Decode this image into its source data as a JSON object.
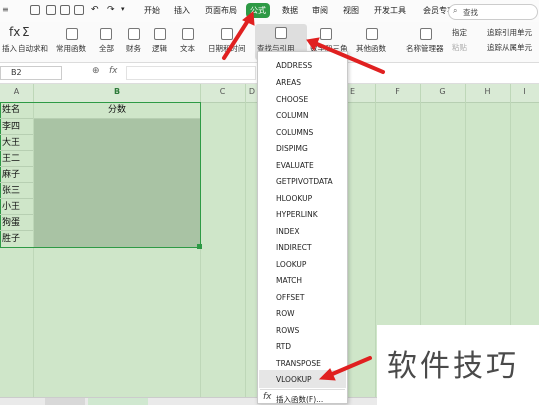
{
  "menu": {
    "items": [
      "开始",
      "插入",
      "页面布局",
      "公式",
      "数据",
      "审阅",
      "视图",
      "开发工具",
      "会员专享"
    ],
    "active": "公式",
    "search_label": "查找"
  },
  "ribbon": {
    "insert_func_label": "插入",
    "buttons": [
      "自动求和",
      "常用函数",
      "全部",
      "财务",
      "逻辑",
      "文本",
      "日期和时间",
      "查找与引用",
      "数学和三角",
      "其他函数",
      "名称管理器"
    ],
    "right_items": [
      "指定",
      "粘贴",
      "追踪引用单元",
      "追踪从属单元"
    ]
  },
  "formula_bar": {
    "cell_ref": "B2",
    "fx": "fx"
  },
  "sheet": {
    "col_headers": [
      "A",
      "B",
      "C",
      "D",
      "E",
      "F",
      "G",
      "H",
      "I"
    ],
    "header_row": [
      "姓名",
      "分数"
    ],
    "names": [
      "李四",
      "大王",
      "王二",
      "麻子",
      "张三",
      "小王",
      "狗蛋",
      "胜子"
    ]
  },
  "dropdown": {
    "items": [
      "ADDRESS",
      "AREAS",
      "CHOOSE",
      "COLUMN",
      "COLUMNS",
      "DISPIMG",
      "EVALUATE",
      "GETPIVOTDATA",
      "HLOOKUP",
      "HYPERLINK",
      "INDEX",
      "INDIRECT",
      "LOOKUP",
      "MATCH",
      "OFFSET",
      "ROW",
      "ROWS",
      "RTD",
      "TRANSPOSE",
      "VLOOKUP"
    ],
    "highlighted": "VLOOKUP",
    "insert_function": "插入函数(F)..."
  },
  "watermark": "软件技巧",
  "colors": {
    "accent": "#2e9a45",
    "arrow": "#e02020",
    "sheet_bg": "#cfe6c9"
  }
}
